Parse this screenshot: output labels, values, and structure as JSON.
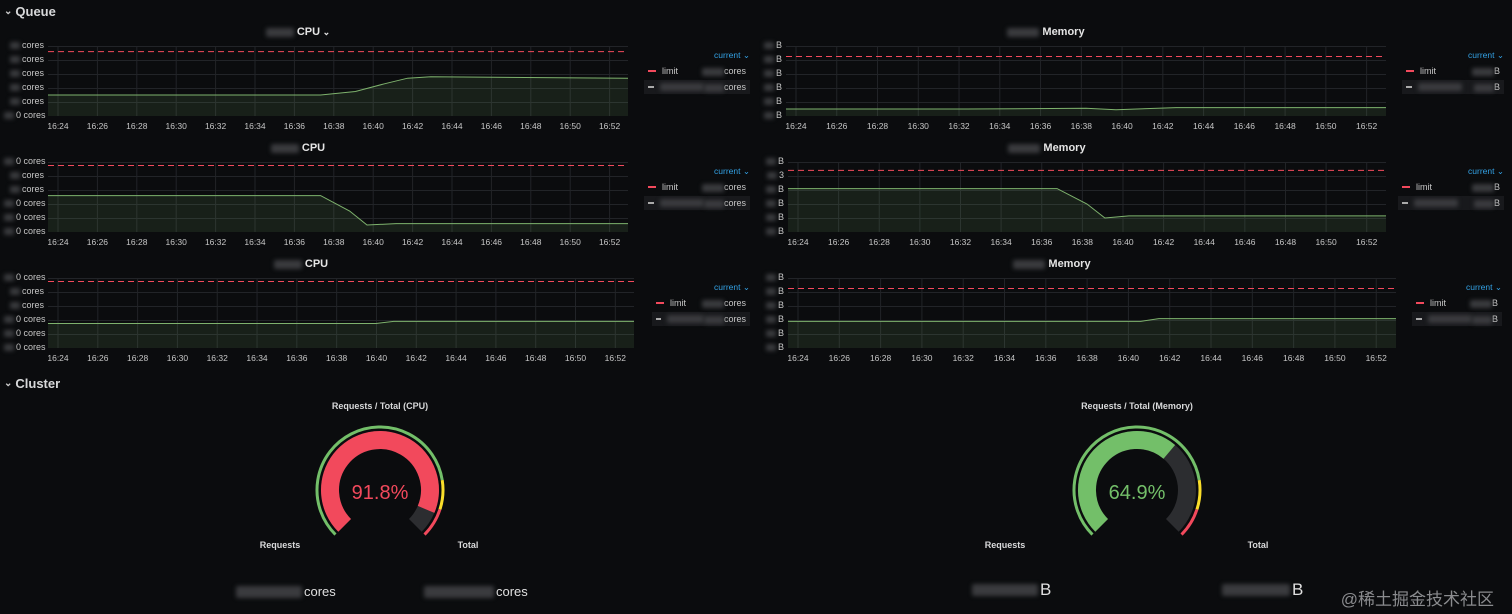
{
  "sections": {
    "queue": "Queue",
    "cluster": "Cluster"
  },
  "time_labels": [
    "16:24",
    "16:26",
    "16:28",
    "16:30",
    "16:32",
    "16:34",
    "16:36",
    "16:38",
    "16:40",
    "16:42",
    "16:44",
    "16:46",
    "16:48",
    "16:50",
    "16:52"
  ],
  "colors": {
    "limit": "#f2495c",
    "series": "#7eb26d",
    "accent": "#33a2e5",
    "gauge_red": "#f2495c",
    "gauge_green": "#73bf69",
    "gauge_yellow": "#fade2a"
  },
  "panels": [
    {
      "title": "CPU",
      "has_dropdown": true,
      "y_ticks": [
        "cores",
        "cores",
        "cores",
        "cores",
        "cores",
        "0 cores"
      ],
      "legend": {
        "header": "current",
        "limit_label": "limit",
        "limit_value": "cores",
        "series_value": "cores"
      },
      "chart_data": {
        "type": "line",
        "limit": 0.92,
        "series": [
          [
            0,
            0.3
          ],
          [
            0.3,
            0.3
          ],
          [
            0.47,
            0.3
          ],
          [
            0.53,
            0.35
          ],
          [
            0.58,
            0.46
          ],
          [
            0.62,
            0.54
          ],
          [
            0.66,
            0.56
          ],
          [
            1,
            0.54
          ]
        ]
      }
    },
    {
      "title": "Memory",
      "has_dropdown": false,
      "y_ticks": [
        "B",
        "B",
        "B",
        "B",
        "B",
        "B"
      ],
      "legend": {
        "header": "current",
        "limit_label": "limit",
        "limit_value": "B",
        "series_value": "B"
      },
      "chart_data": {
        "type": "line",
        "limit": 0.85,
        "series": [
          [
            0,
            0.1
          ],
          [
            0.3,
            0.1
          ],
          [
            0.5,
            0.11
          ],
          [
            0.55,
            0.09
          ],
          [
            0.65,
            0.12
          ],
          [
            1,
            0.12
          ]
        ]
      }
    },
    {
      "title": "CPU",
      "has_dropdown": false,
      "y_ticks": [
        "0 cores",
        "cores",
        "cores",
        "0 cores",
        "0 cores",
        "0 cores"
      ],
      "legend": {
        "header": "current",
        "limit_label": "limit",
        "limit_value": "cores",
        "series_value": "cores"
      },
      "chart_data": {
        "type": "line",
        "limit": 0.95,
        "series": [
          [
            0,
            0.52
          ],
          [
            0.47,
            0.52
          ],
          [
            0.52,
            0.3
          ],
          [
            0.55,
            0.1
          ],
          [
            0.6,
            0.12
          ],
          [
            1,
            0.12
          ]
        ]
      }
    },
    {
      "title": "Memory",
      "has_dropdown": false,
      "y_ticks": [
        "B",
        "3",
        "B",
        "B",
        "B",
        "B"
      ],
      "legend": {
        "header": "current",
        "limit_label": "limit",
        "limit_value": "B",
        "series_value": "B"
      },
      "chart_data": {
        "type": "line",
        "limit": 0.88,
        "series": [
          [
            0,
            0.62
          ],
          [
            0.45,
            0.62
          ],
          [
            0.5,
            0.4
          ],
          [
            0.53,
            0.2
          ],
          [
            0.57,
            0.23
          ],
          [
            1,
            0.23
          ]
        ]
      }
    },
    {
      "title": "CPU",
      "has_dropdown": false,
      "y_ticks": [
        "0 cores",
        "cores",
        "cores",
        "0 cores",
        "0 cores",
        "0 cores"
      ],
      "legend": {
        "header": "current",
        "limit_label": "limit",
        "limit_value": "cores",
        "series_value": "cores"
      },
      "chart_data": {
        "type": "line",
        "limit": 0.95,
        "series": [
          [
            0,
            0.35
          ],
          [
            0.56,
            0.35
          ],
          [
            0.59,
            0.38
          ],
          [
            1,
            0.38
          ]
        ]
      }
    },
    {
      "title": "Memory",
      "has_dropdown": false,
      "y_ticks": [
        "B",
        "B",
        "B",
        "B",
        "B",
        "B"
      ],
      "legend": {
        "header": "current",
        "limit_label": "limit",
        "limit_value": "B",
        "series_value": "B"
      },
      "chart_data": {
        "type": "line",
        "limit": 0.85,
        "series": [
          [
            0,
            0.38
          ],
          [
            0.58,
            0.38
          ],
          [
            0.61,
            0.42
          ],
          [
            1,
            0.42
          ]
        ]
      }
    }
  ],
  "gauges": [
    {
      "title": "Requests / Total (CPU)",
      "value": 91.8,
      "display": "91.8%",
      "color": "#f2495c"
    },
    {
      "title": "Requests / Total (Memory)",
      "value": 64.9,
      "display": "64.9%",
      "color": "#73bf69"
    }
  ],
  "stats": [
    {
      "title": "Requests",
      "unit": "cores"
    },
    {
      "title": "Total",
      "unit": "cores"
    },
    {
      "title": "Requests",
      "unit": "B"
    },
    {
      "title": "Total",
      "unit": "B"
    }
  ],
  "watermark": "@稀土掘金技术社区"
}
